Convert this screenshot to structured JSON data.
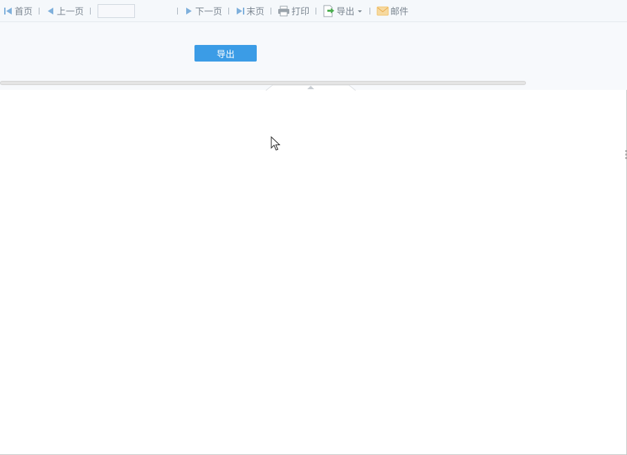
{
  "toolbar": {
    "first_page": {
      "label": "首页",
      "icon": "first-page-icon"
    },
    "prev_page": {
      "label": "上一页",
      "icon": "prev-page-icon"
    },
    "page_input": {
      "value": "",
      "placeholder": ""
    },
    "next_page": {
      "label": "下一页",
      "icon": "next-page-icon"
    },
    "last_page": {
      "label": "末页",
      "icon": "last-page-icon"
    },
    "print": {
      "label": "打印",
      "icon": "printer-icon"
    },
    "export": {
      "label": "导出",
      "icon": "export-icon",
      "dropdown_icon": "caret-down-icon"
    },
    "mail": {
      "label": "邮件",
      "icon": "mail-icon"
    }
  },
  "panel": {
    "export_button_label": "导出"
  },
  "colors": {
    "toolbar_bg": "#f5f8fb",
    "toolbar_text": "#7a8590",
    "nav_icon": "#7fb0dc",
    "accent_button": "#3b9ce6",
    "export_icon_green": "#4caf50",
    "mail_icon": "#f2c46d"
  }
}
